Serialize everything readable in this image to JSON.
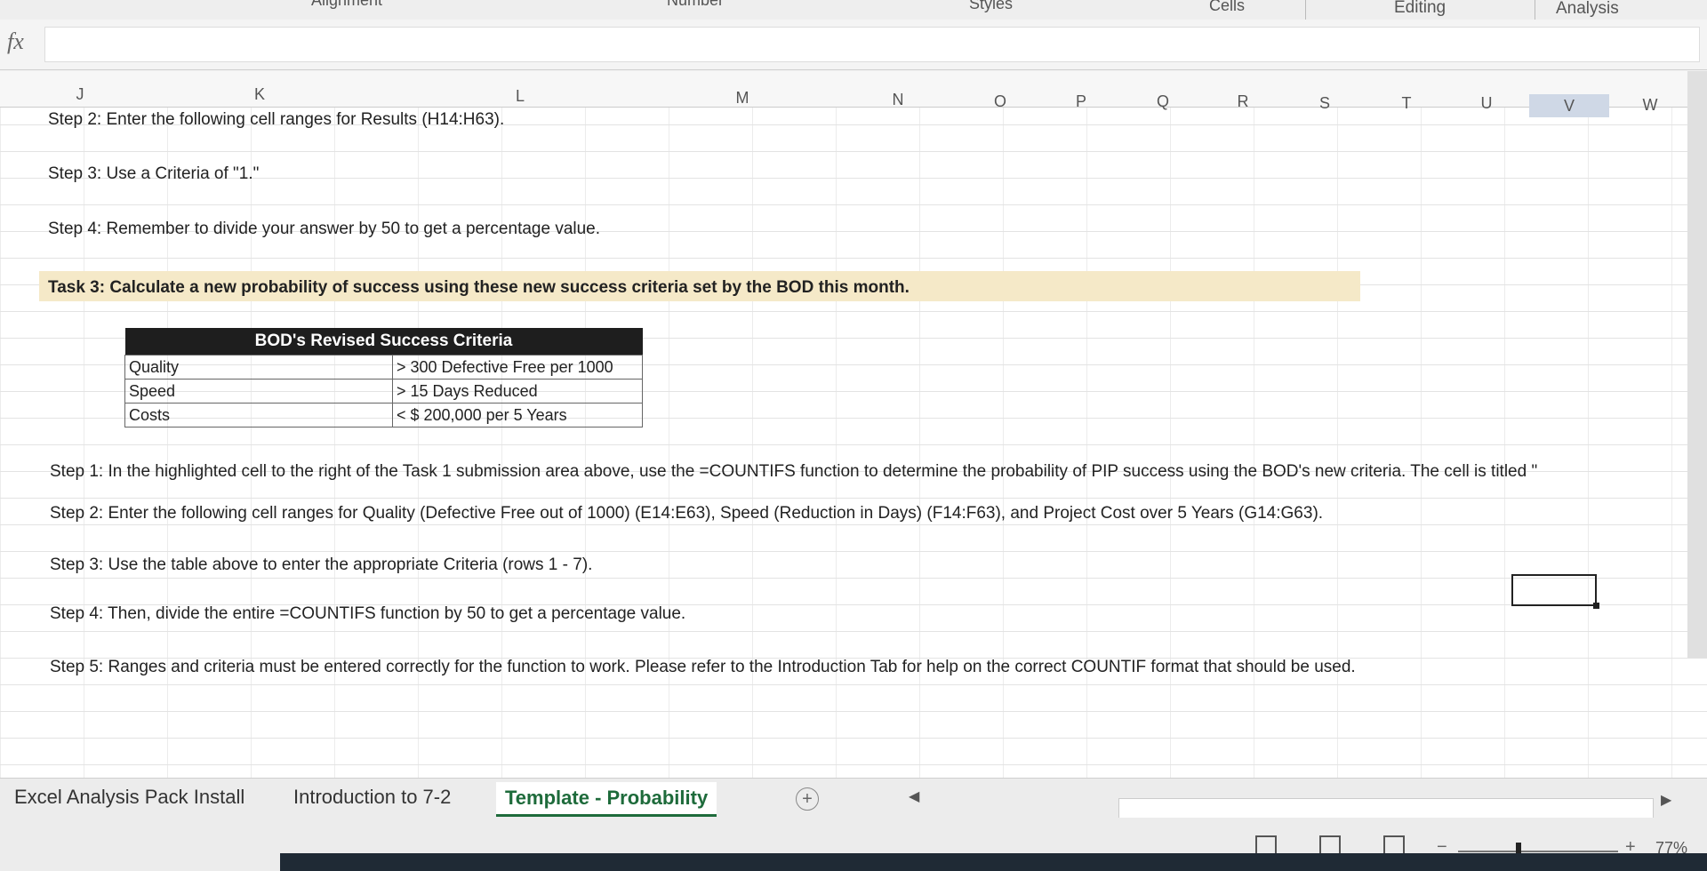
{
  "ribbon": {
    "groups": [
      "Alignment",
      "Number",
      "Styles",
      "Cells",
      "Editing",
      "Analysis"
    ]
  },
  "formula_bar": {
    "fx_label": "fx",
    "value": ""
  },
  "columns": [
    "J",
    "K",
    "L",
    "M",
    "N",
    "O",
    "P",
    "Q",
    "R",
    "S",
    "T",
    "U",
    "V",
    "W"
  ],
  "selected_column": "V",
  "steps_top": [
    "Step 2: Enter the following cell ranges for Results (H14:H63).",
    "Step 3: Use a Criteria of \"1.\"",
    "Step 4: Remember to divide your answer by 50 to get a percentage value."
  ],
  "task3": "Task 3: Calculate a new probability of success using these new success criteria set by the BOD this month.",
  "criteria_table": {
    "title": "BOD's Revised Success Criteria",
    "rows": [
      {
        "label": "Quality",
        "value": "> 300 Defective Free per 1000"
      },
      {
        "label": "Speed",
        "value": "> 15 Days Reduced"
      },
      {
        "label": "Costs",
        "value": "< $ 200,000 per 5 Years"
      }
    ]
  },
  "steps_bottom": [
    "Step 1: In the highlighted cell to the right of the Task 1 submission area above, use the =COUNTIFS function to determine the probability of PIP success using the BOD's new criteria. The cell is titled \"",
    "Step 2: Enter the following cell ranges for Quality (Defective Free out of 1000) (E14:E63), Speed (Reduction in Days) (F14:F63), and Project Cost over 5 Years (G14:G63).",
    "Step 3: Use the table above to enter the appropriate Criteria (rows 1 - 7).",
    "Step 4: Then, divide the entire =COUNTIFS function by 50 to get a percentage value.",
    "Step 5: Ranges and criteria must be entered correctly for the function to work. Please refer to the Introduction Tab for help on the correct COUNTIF format that should be used."
  ],
  "sheet_tabs": [
    "Excel Analysis Pack Install",
    "Introduction to 7-2",
    "Template - Probability"
  ],
  "active_tab": "Template - Probability",
  "add_sheet_symbol": "+",
  "zoom": {
    "minus": "−",
    "plus": "+",
    "level": "77%"
  }
}
